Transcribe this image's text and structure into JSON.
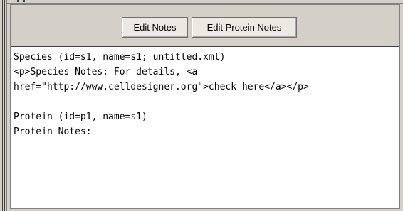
{
  "toolbar": {
    "edit_notes_label": "Edit Notes",
    "edit_protein_notes_label": "Edit Protein Notes"
  },
  "editor": {
    "lines": [
      "Species (id=s1, name=s1; untitled.xml)",
      "<p>Species Notes: For details, <a",
      "href=\"http://www.celldesigner.org\">check here</a></p>",
      "",
      "Protein (id=p1, name=s1)",
      "Protein Notes:"
    ]
  },
  "colors": {
    "window_background": "#d4d0c8",
    "editor_background": "#ffffff",
    "text": "#000000"
  }
}
